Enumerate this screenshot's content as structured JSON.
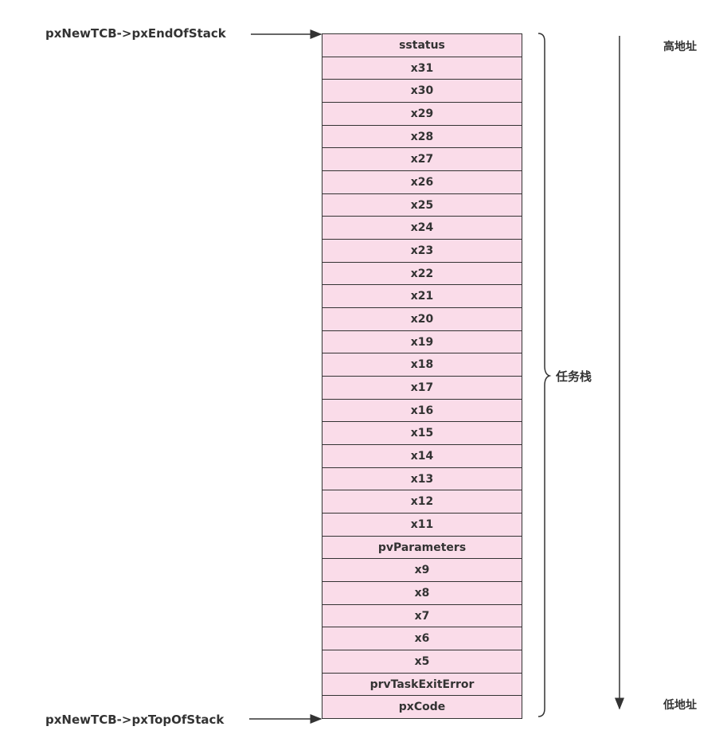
{
  "pointers": {
    "end_of_stack": "pxNewTCB->pxEndOfStack",
    "top_of_stack": "pxNewTCB->pxTopOfStack"
  },
  "stack_rows": [
    "sstatus",
    "x31",
    "x30",
    "x29",
    "x28",
    "x27",
    "x26",
    "x25",
    "x24",
    "x23",
    "x22",
    "x21",
    "x20",
    "x19",
    "x18",
    "x17",
    "x16",
    "x15",
    "x14",
    "x13",
    "x12",
    "x11",
    "pvParameters",
    "x9",
    "x8",
    "x7",
    "x6",
    "x5",
    "prvTaskExitError",
    "pxCode"
  ],
  "brace_label": "任务栈",
  "address": {
    "high": "高地址",
    "low": "低地址"
  },
  "colors": {
    "cell_fill": "#fadce9",
    "stroke": "#333333"
  }
}
